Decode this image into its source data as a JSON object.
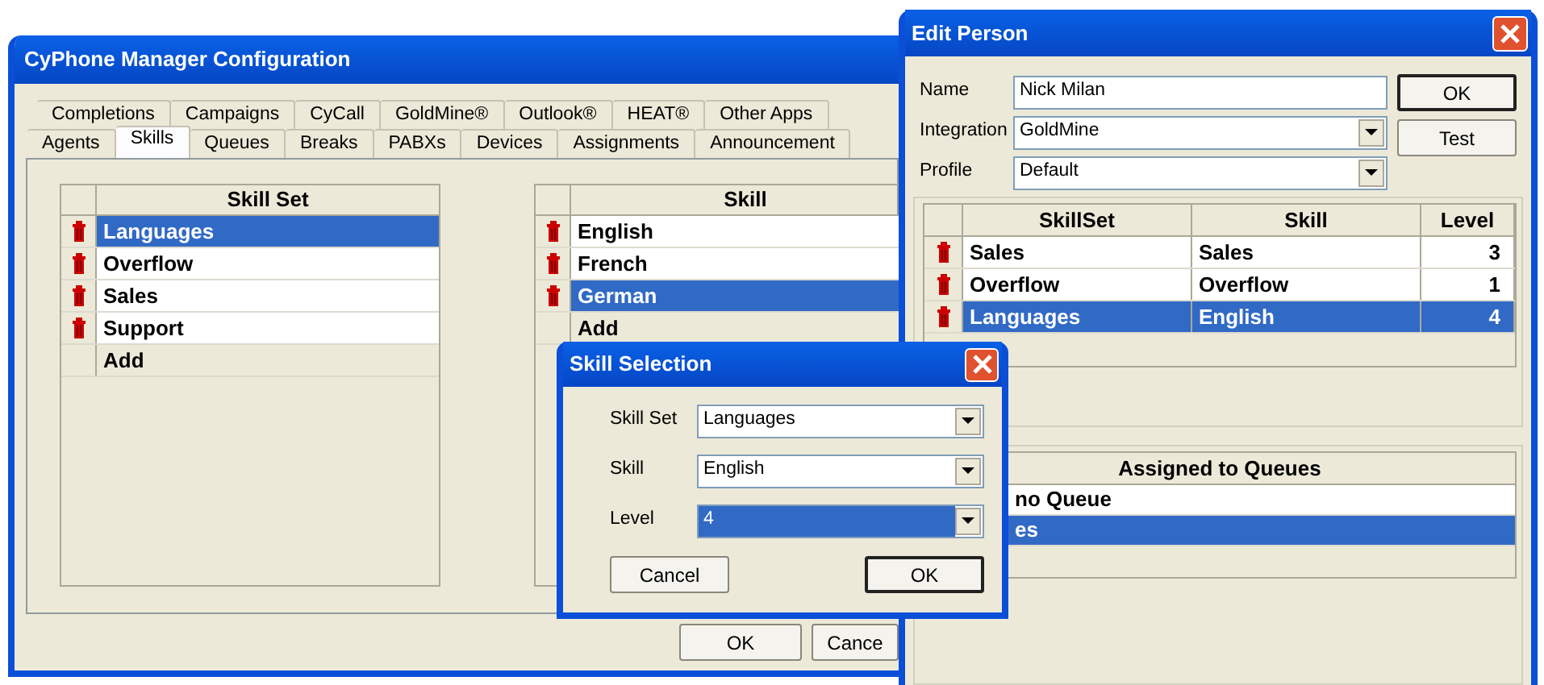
{
  "main_window": {
    "title": "CyPhone Manager Configuration",
    "tab_rows": [
      [
        {
          "label": "Completions",
          "selected": false
        },
        {
          "label": "Campaigns",
          "selected": false
        },
        {
          "label": "CyCall",
          "selected": false
        },
        {
          "label": "GoldMine®",
          "selected": false
        },
        {
          "label": "Outlook®",
          "selected": false
        },
        {
          "label": "HEAT®",
          "selected": false
        },
        {
          "label": "Other Apps",
          "selected": false
        }
      ],
      [
        {
          "label": "Agents",
          "selected": false
        },
        {
          "label": "Skills",
          "selected": true
        },
        {
          "label": "Queues",
          "selected": false
        },
        {
          "label": "Breaks",
          "selected": false
        },
        {
          "label": "PABXs",
          "selected": false
        },
        {
          "label": "Devices",
          "selected": false
        },
        {
          "label": "Assignments",
          "selected": false
        },
        {
          "label": "Announcement",
          "selected": false
        }
      ]
    ],
    "tables": [
      {
        "column": "Skill Set",
        "rows": [
          {
            "text": "Languages",
            "deletable": true,
            "selected": true
          },
          {
            "text": "Overflow",
            "deletable": true,
            "selected": false
          },
          {
            "text": "Sales",
            "deletable": true,
            "selected": false
          },
          {
            "text": "Support",
            "deletable": true,
            "selected": false
          },
          {
            "text": "Add",
            "deletable": false,
            "selected": false
          }
        ]
      },
      {
        "column": "Skill",
        "rows": [
          {
            "text": "English",
            "deletable": true,
            "selected": false
          },
          {
            "text": "French",
            "deletable": true,
            "selected": false
          },
          {
            "text": "German",
            "deletable": true,
            "selected": true
          },
          {
            "text": "Add",
            "deletable": false,
            "selected": false
          }
        ]
      }
    ],
    "buttons": [
      {
        "label": "OK",
        "default": false
      },
      {
        "label": "Cance",
        "default": false
      }
    ]
  },
  "edit_person": {
    "title": "Edit Person",
    "fields": [
      {
        "label": "Name",
        "value": "Nick Milan",
        "kind": "text"
      },
      {
        "label": "Integration",
        "value": "GoldMine",
        "kind": "dropdown"
      },
      {
        "label": "Profile",
        "value": "Default",
        "kind": "dropdown"
      }
    ],
    "buttons": [
      {
        "label": "OK",
        "default": true
      },
      {
        "label": "Test",
        "default": false
      }
    ],
    "skills_table": {
      "columns": [
        "SkillSet",
        "Skill",
        "Level"
      ],
      "rows": [
        {
          "cells": [
            "Sales",
            "Sales",
            "3"
          ],
          "selected": false
        },
        {
          "cells": [
            "Overflow",
            "Overflow",
            "1"
          ],
          "selected": false
        },
        {
          "cells": [
            "Languages",
            "English",
            "4"
          ],
          "selected": true
        }
      ]
    },
    "queues": {
      "header": "Assigned to Queues",
      "items": [
        {
          "text": "no Queue",
          "selected": false
        },
        {
          "text": "es",
          "selected": true
        }
      ]
    }
  },
  "skill_selection": {
    "title": "Skill Selection",
    "fields": [
      {
        "label": "Skill Set",
        "value": "Languages",
        "highlighted": false
      },
      {
        "label": "Skill",
        "value": "English",
        "highlighted": false
      },
      {
        "label": "Level",
        "value": "4",
        "highlighted": true
      }
    ],
    "buttons": [
      {
        "label": "Cancel",
        "default": false
      },
      {
        "label": "OK",
        "default": true
      }
    ]
  }
}
